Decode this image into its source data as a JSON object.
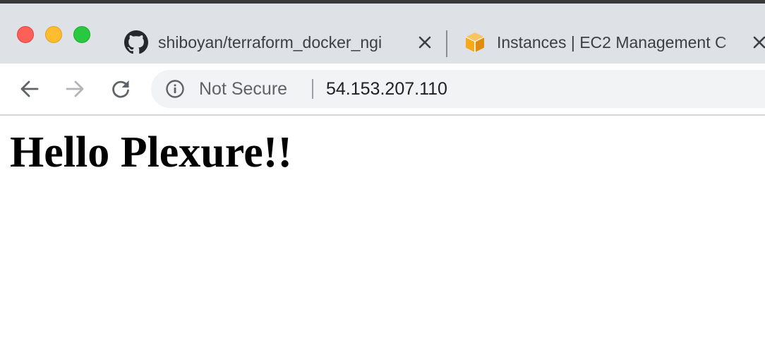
{
  "browser": {
    "tabs": [
      {
        "title": "shiboyan/terraform_docker_ngi",
        "icon": "github-icon"
      },
      {
        "title": "Instances | EC2 Management C",
        "icon": "aws-box-icon"
      }
    ],
    "omnibox": {
      "security_label": "Not Secure",
      "url": "54.153.207.110"
    }
  },
  "page": {
    "heading": "Hello Plexure!!"
  },
  "colors": {
    "tabstrip_bg": "#dee1e6",
    "close_light": "#fe5f57",
    "minimize_light": "#febc2e",
    "maximize_light": "#28c840",
    "aws_orange": "#f7a81b"
  }
}
